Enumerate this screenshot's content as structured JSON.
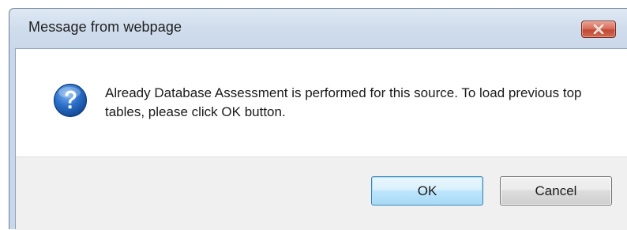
{
  "window": {
    "title": "Message from webpage",
    "close_icon": "close-icon"
  },
  "message": {
    "icon": "question-icon",
    "text": "Already Database Assessment is performed for this source. To load previous top tables, please click OK button."
  },
  "buttons": {
    "ok_label": "OK",
    "cancel_label": "Cancel"
  },
  "colors": {
    "close_button": "#c24a34",
    "ok_border": "#3c7fb1",
    "icon_blue": "#1f5fb8"
  }
}
